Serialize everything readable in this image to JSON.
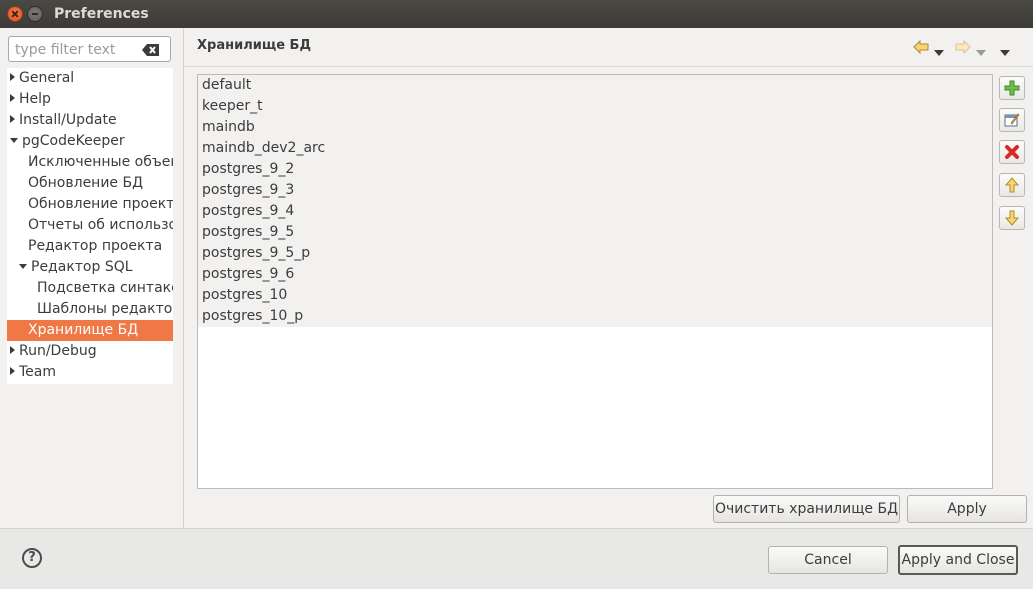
{
  "window": {
    "title": "Preferences"
  },
  "filter": {
    "placeholder": "type filter text"
  },
  "tree": [
    {
      "label": "General",
      "expander": "collapsed"
    },
    {
      "label": "Help",
      "expander": "collapsed"
    },
    {
      "label": "Install/Update",
      "expander": "collapsed"
    },
    {
      "label": "pgCodeKeeper",
      "expander": "expanded"
    },
    {
      "label": "Исключенные объекты",
      "expander": "none"
    },
    {
      "label": "Обновление БД",
      "expander": "none"
    },
    {
      "label": "Обновление проекта",
      "expander": "none"
    },
    {
      "label": "Отчеты об использовании",
      "expander": "none"
    },
    {
      "label": "Редактор проекта",
      "expander": "none"
    },
    {
      "label": "Редактор SQL",
      "expander": "expanded"
    },
    {
      "label": "Подсветка синтаксиса",
      "expander": "none"
    },
    {
      "label": "Шаблоны редактора",
      "expander": "none"
    },
    {
      "label": "Хранилище БД",
      "expander": "none",
      "selected": true
    },
    {
      "label": "Run/Debug",
      "expander": "collapsed"
    },
    {
      "label": "Team",
      "expander": "collapsed"
    }
  ],
  "page": {
    "title": "Хранилище БД"
  },
  "db_list": [
    "default",
    "keeper_t",
    "maindb",
    "maindb_dev2_arc",
    "postgres_9_2",
    "postgres_9_3",
    "postgres_9_4",
    "postgres_9_5",
    "postgres_9_5_p",
    "postgres_9_6",
    "postgres_10",
    "postgres_10_p"
  ],
  "side_buttons": [
    "add-icon",
    "edit-icon",
    "delete-icon",
    "move-up-icon",
    "move-down-icon"
  ],
  "buttons": {
    "clear_store": "Очистить хранилище БД",
    "apply": "Apply",
    "cancel": "Cancel",
    "apply_close": "Apply and Close"
  },
  "help": {
    "glyph": "?"
  },
  "colors": {
    "selection": "#f07746",
    "titlebar": "#3c3b37"
  }
}
